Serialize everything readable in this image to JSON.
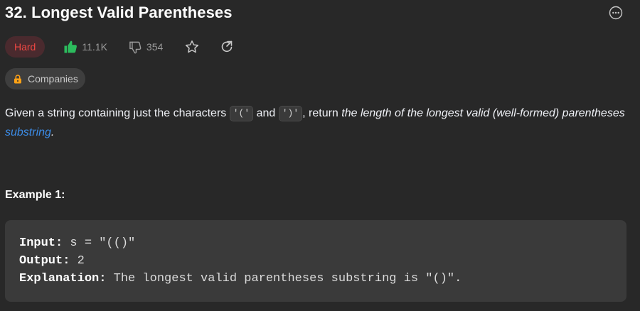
{
  "problem": {
    "title": "32. Longest Valid Parentheses",
    "difficulty": "Hard",
    "likes": "11.1K",
    "dislikes": "354",
    "companies_label": "Companies"
  },
  "icons": {
    "more": "more-horizontal-icon",
    "like": "thumbs-up-icon",
    "dislike": "thumbs-down-icon",
    "star": "star-icon",
    "share": "share-icon",
    "lock": "lock-icon"
  },
  "description": {
    "part1": "Given a string containing just the characters ",
    "char_open": "'('",
    "and": " and ",
    "char_close": "')'",
    "part2": ", return ",
    "emphasis1": "the length of the longest valid (well-formed) parentheses ",
    "link": "substring",
    "end": "."
  },
  "example": {
    "heading": "Example 1:",
    "input_label": "Input:",
    "input_value": " s = \"(()\"",
    "output_label": "Output:",
    "output_value": " 2",
    "explanation_label": "Explanation:",
    "explanation_value": " The longest valid parentheses substring is \"()\"."
  },
  "colors": {
    "background": "#282828",
    "hard_text": "#ef4743",
    "hard_bg": "#4a2a2e",
    "like_green": "#2cbb5d",
    "link_blue": "#3c8ce7",
    "lock_orange": "#ffa116"
  }
}
